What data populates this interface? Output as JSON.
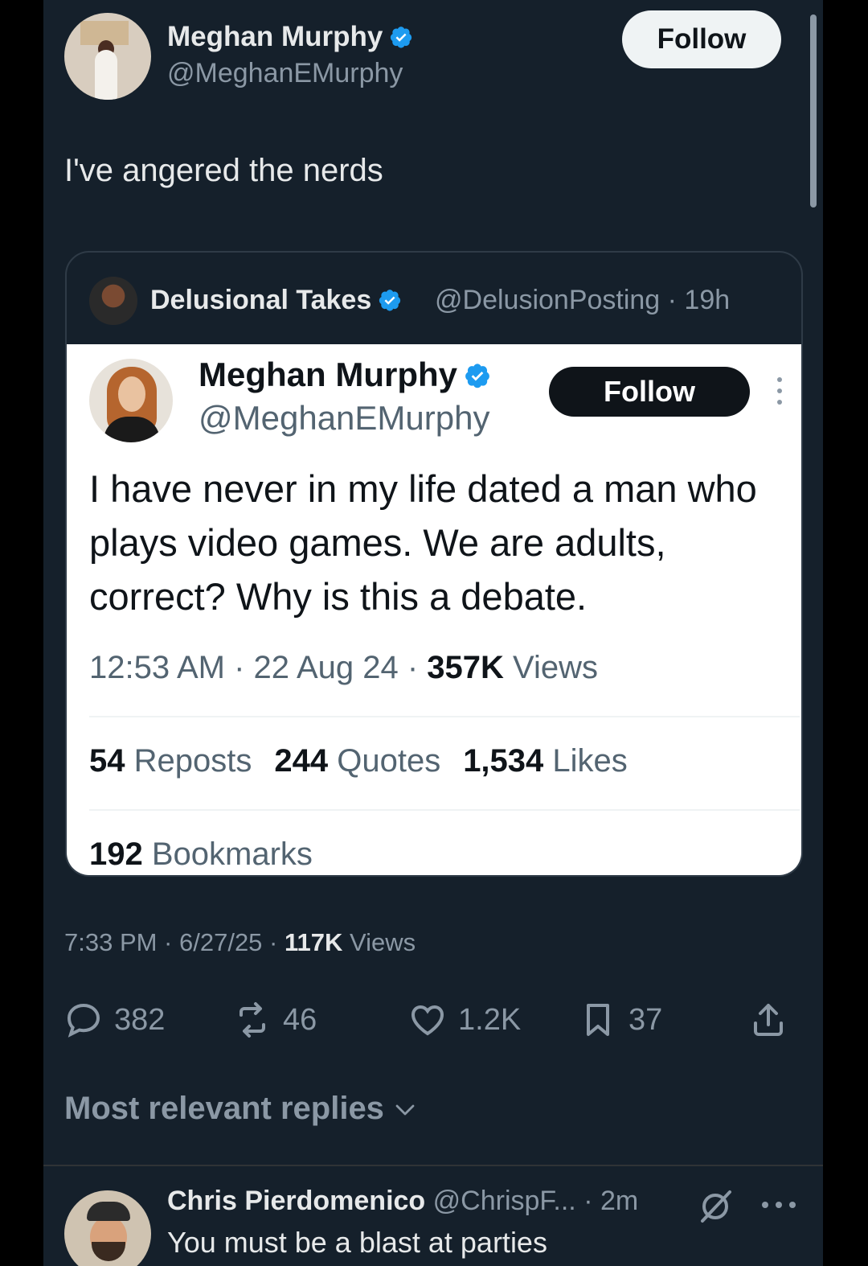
{
  "post": {
    "author_name": "Meghan Murphy",
    "author_handle": "@MeghanEMurphy",
    "follow_label": "Follow",
    "text": "I've angered the nerds",
    "timestamp": "7:33 PM · 6/27/25 · ",
    "views_count": "117K",
    "views_label": " Views"
  },
  "quote": {
    "author_name": "Delusional Takes",
    "author_handle_time": "@DelusionPosting · 19h",
    "screenshot": {
      "author_name": "Meghan Murphy",
      "author_handle": "@MeghanEMurphy",
      "follow_label": "Follow",
      "text": "I have never in my life dated a man who plays video games. We are adults, correct? Why is this a debate.",
      "meta_prefix": "12:53 AM · 22 Aug 24 · ",
      "views_count": "357K",
      "views_label": " Views",
      "reposts_count": "54",
      "reposts_label": " Reposts",
      "quotes_count": "244",
      "quotes_label": " Quotes",
      "likes_count": "1,534",
      "likes_label": " Likes",
      "bookmarks_count": "192",
      "bookmarks_label": " Bookmarks"
    }
  },
  "actions": {
    "replies": "382",
    "reposts": "46",
    "likes": "1.2K",
    "bookmarks": "37"
  },
  "replies_sort_label": "Most relevant replies",
  "reply": {
    "author_name": "Chris Pierdomenico",
    "handle_time": " @ChrispF... · 2m",
    "text": "You must be a blast at parties"
  },
  "colors": {
    "background": "#15202b",
    "verified": "#1d9bf0",
    "text_primary": "#e7e9ea",
    "text_secondary": "#8b98a5"
  }
}
